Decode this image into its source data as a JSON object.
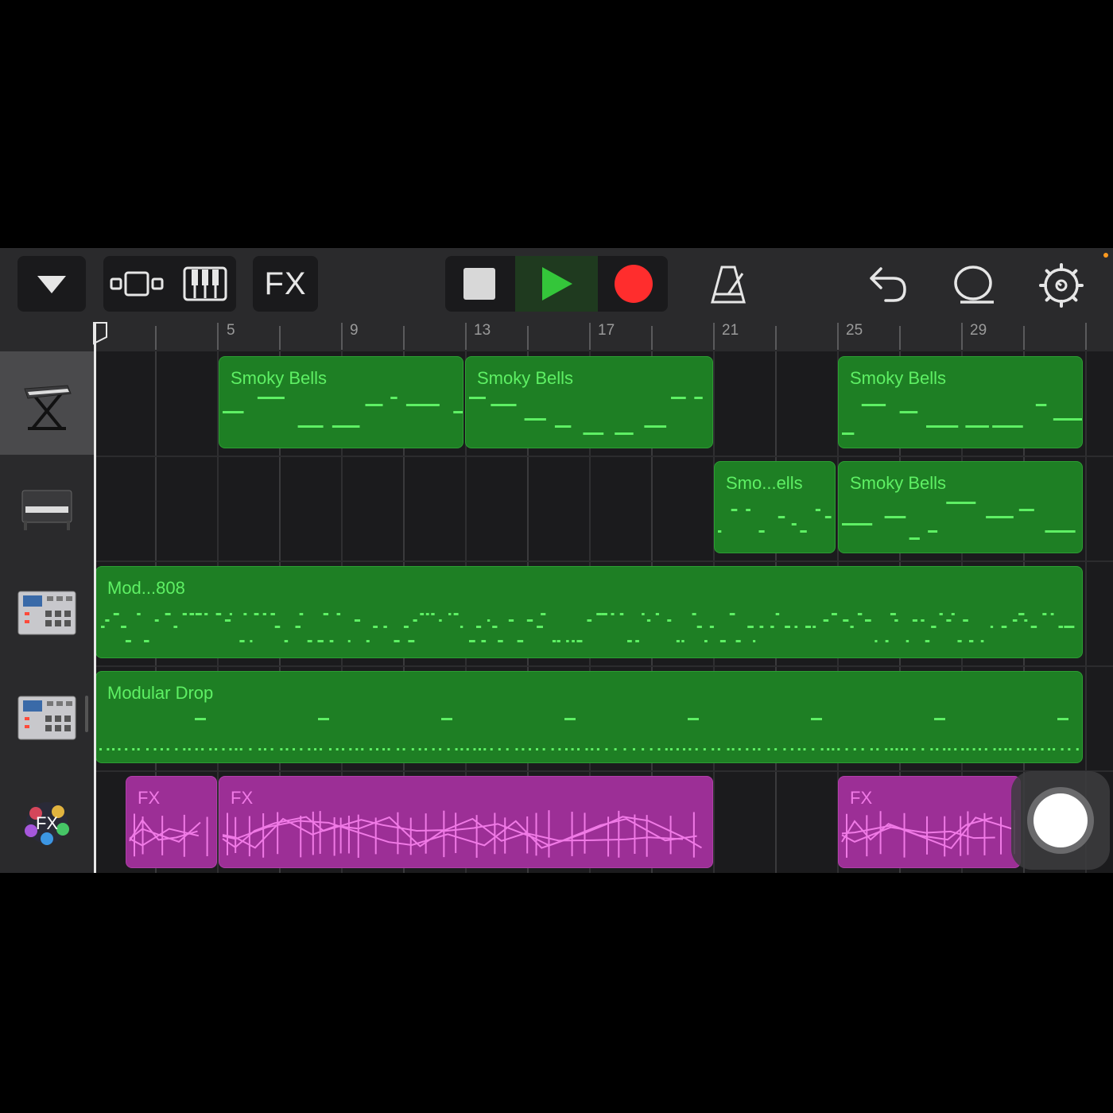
{
  "toolbar": {
    "fx_button": "FX",
    "colors": {
      "play_active": "#34c63a",
      "record": "#ff2d2d",
      "stop": "#d8d8d8"
    }
  },
  "ruler": {
    "bar_numbers": [
      "5",
      "9",
      "13",
      "17",
      "21",
      "25",
      "29"
    ],
    "add_label": "+"
  },
  "tracks": [
    {
      "instrument": "keyboard-stand",
      "selected": true
    },
    {
      "instrument": "electric-piano",
      "selected": false
    },
    {
      "instrument": "drum-machine",
      "selected": false
    },
    {
      "instrument": "drum-machine",
      "selected": false
    },
    {
      "instrument": "fx",
      "selected": false
    }
  ],
  "regions": {
    "track1": [
      "Smoky Bells",
      "Smoky Bells",
      "Smoky Bells"
    ],
    "track2": [
      "Smo...ells",
      "Smoky Bells"
    ],
    "track3": [
      "Mod...808"
    ],
    "track4": [
      "Modular Drop"
    ],
    "track5": [
      "FX",
      "FX",
      "FX"
    ]
  },
  "track5_fx_label": "FX",
  "colors": {
    "green_region": "#1e7f24",
    "green_notes": "#5ef064",
    "purple_region": "#9c2f96",
    "purple_lines": "#f07ae6",
    "background": "#1b1b1d"
  }
}
